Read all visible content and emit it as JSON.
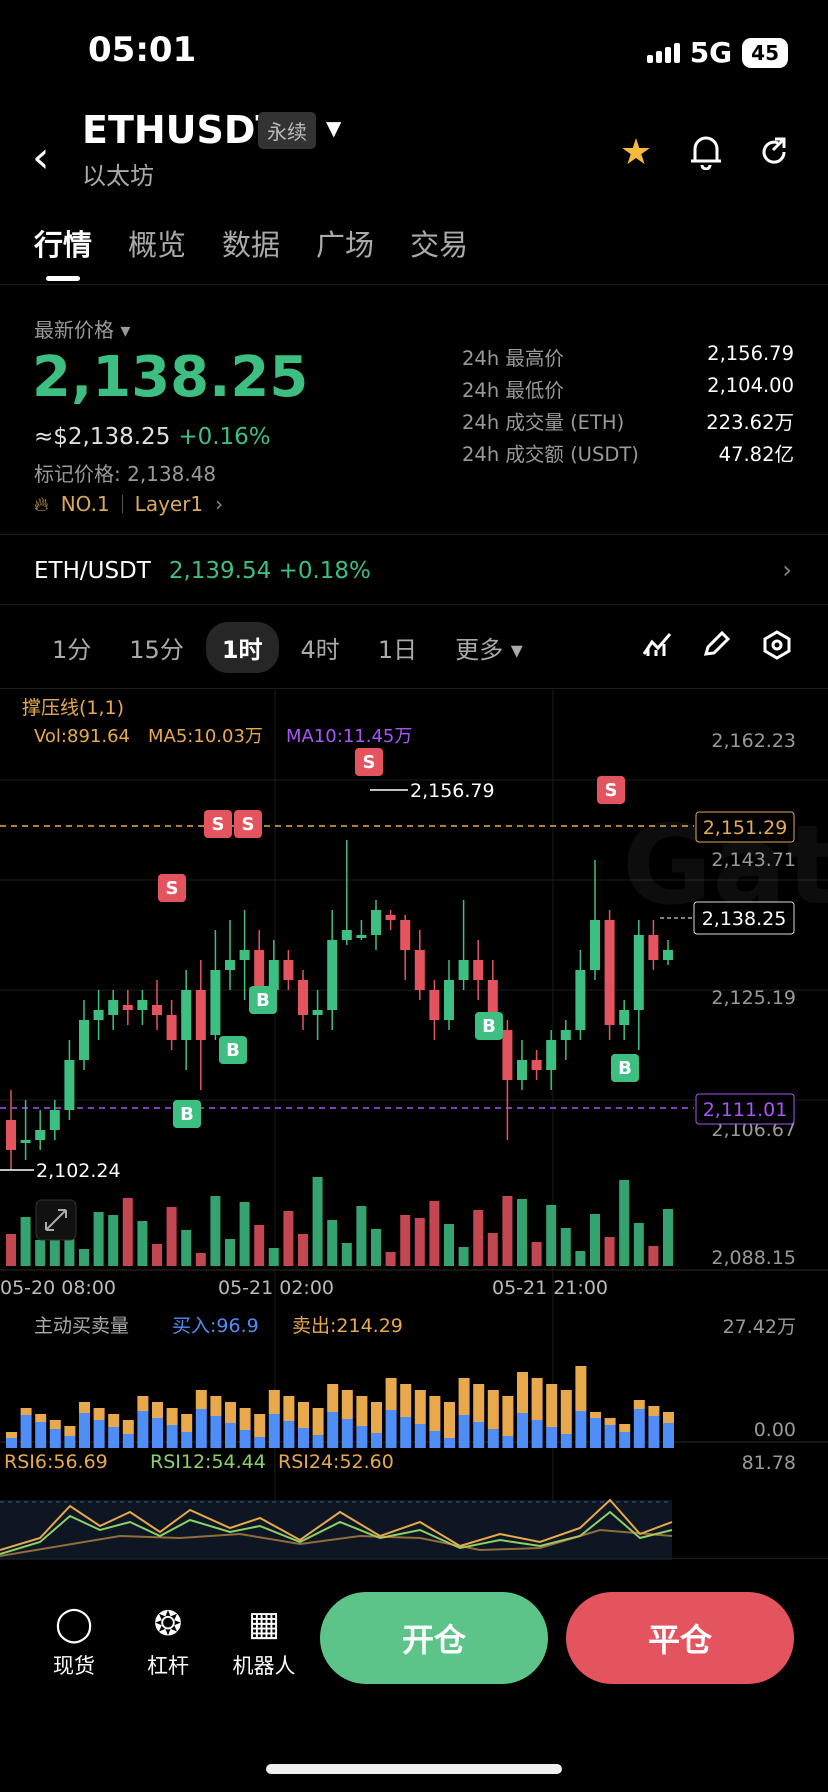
{
  "status": {
    "time": "05:01",
    "network": "5G",
    "battery": "45"
  },
  "header": {
    "symbol": "ETHUSDT",
    "badge": "永续",
    "name": "以太坊"
  },
  "tabs": [
    "行情",
    "概览",
    "数据",
    "广场",
    "交易"
  ],
  "price": {
    "label": "最新价格",
    "last": "2,138.25",
    "usd": "≈$2,138.25",
    "change": "+0.16%",
    "mark": "标记价格: 2,138.48",
    "tag_rank": "NO.1",
    "tag_sector": "Layer1"
  },
  "stats": [
    {
      "k": "24h 最高价",
      "v": "2,156.79"
    },
    {
      "k": "24h 最低价",
      "v": "2,104.00"
    },
    {
      "k": "24h 成交量 (ETH)",
      "v": "223.62万"
    },
    {
      "k": "24h 成交额 (USDT)",
      "v": "47.82亿"
    }
  ],
  "spot": {
    "pair": "ETH/USDT",
    "price": "2,139.54",
    "change": "+0.18%"
  },
  "timeframes": [
    "1分",
    "15分",
    "1时",
    "4时",
    "1日",
    "更多"
  ],
  "timeframe_active": "1时",
  "chart": {
    "indicator_title": "撑压线(1,1)",
    "vol": "Vol:891.64",
    "ma5": "MA5:10.03万",
    "ma10": "MA10:11.45万",
    "axis_prices": [
      "2,162.23",
      "2,143.71",
      "2,125.19",
      "2,106.67",
      "2,088.15"
    ],
    "resistance": "2,151.29",
    "support": "2,111.01",
    "current": "2,138.25",
    "high_label": "2,156.79",
    "low_label": "2,102.24",
    "dates": [
      "05-20 08:00",
      "05-21 02:00",
      "05-21 21:00"
    ],
    "signal_sell": "S",
    "signal_buy": "B",
    "watermark": "Gate"
  },
  "flow": {
    "title": "主动买卖量",
    "buy": "买入:96.9",
    "sell": "卖出:214.29",
    "max": "27.42万",
    "min": "0.00"
  },
  "rsi": {
    "rsi6": "RSI6:56.69",
    "rsi12": "RSI12:54.44",
    "rsi24": "RSI24:52.60",
    "max": "81.78"
  },
  "colors": {
    "up": "#3dbf82",
    "down": "#e4545f",
    "accent": "#f6b93b",
    "purple": "#a855f7"
  },
  "bottom": {
    "items": [
      {
        "label": "现货",
        "icon": "spot-icon"
      },
      {
        "label": "杠杆",
        "icon": "leverage-icon"
      },
      {
        "label": "机器人",
        "icon": "robot-icon"
      }
    ],
    "open": "开仓",
    "close": "平仓"
  }
}
